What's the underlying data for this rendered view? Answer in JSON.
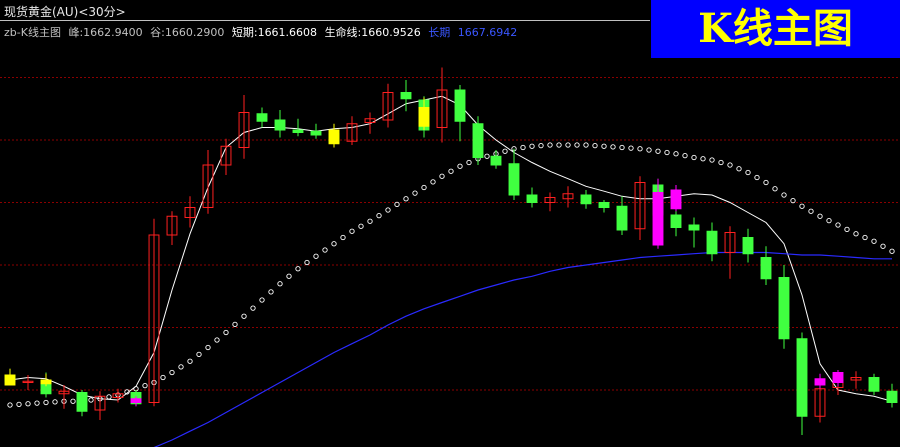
{
  "header": {
    "instrument_title": "现货黄金(AU)<30分>",
    "indicator_name": "zb-K线主图",
    "peak_label": "峰:1662.9400",
    "trough_label": "谷:1660.2900",
    "short_term_label": "短期:1661.6608",
    "lifeline_label": "生命线:1660.9526",
    "long_term_label": "长期",
    "long_term_value": "1667.6942"
  },
  "badge": {
    "text": "K线主图"
  },
  "colors": {
    "background": "#000000",
    "up_candle": "#ff2020",
    "down_candle": "#40ff40",
    "highlight_candle_yellow": "#ffff00",
    "highlight_candle_magenta": "#ff00ff",
    "short_term_line": "#ffffff",
    "long_term_line": "#2a2aff",
    "lifeline_dots": "#ffffff",
    "grid": "#8b0000",
    "badge_bg": "#0000ff",
    "badge_text": "#ffff00"
  },
  "chart_data": {
    "type": "candlestick",
    "title": "现货黄金(AU)<30分>",
    "ylim": [
      1636,
      1668
    ],
    "grid": true,
    "series": [
      {
        "name": "短期",
        "color": "#ffffff",
        "values": [
          1640.8,
          1641.0,
          1640.9,
          1640.3,
          1639.6,
          1639.3,
          1639.2,
          1640.3,
          1643.0,
          1648.0,
          1652.5,
          1656.2,
          1659.4,
          1660.6,
          1661.0,
          1661.0,
          1660.9,
          1660.7,
          1660.9,
          1661.0,
          1661.3,
          1662.1,
          1662.9,
          1663.2,
          1663.5,
          1662.8,
          1661.2,
          1660.0,
          1659.0,
          1658.2,
          1657.5,
          1656.9,
          1656.3,
          1655.9,
          1655.5,
          1655.3,
          1655.3,
          1655.5,
          1655.7,
          1655.6,
          1655.0,
          1654.2,
          1653.4,
          1651.7,
          1647.6,
          1642.1,
          1640.0,
          1639.7,
          1639.5,
          1639.1
        ]
      },
      {
        "name": "生命线",
        "color": "#ffffff",
        "values": [
          1638.8,
          1638.9,
          1639.0,
          1639.1,
          1639.1,
          1639.3,
          1639.6,
          1640.1,
          1640.6,
          1641.4,
          1642.3,
          1643.4,
          1644.6,
          1645.9,
          1647.2,
          1648.5,
          1649.7,
          1650.7,
          1651.7,
          1652.7,
          1653.5,
          1654.4,
          1655.3,
          1656.2,
          1657.1,
          1657.9,
          1658.5,
          1658.9,
          1659.3,
          1659.5,
          1659.6,
          1659.6,
          1659.6,
          1659.5,
          1659.4,
          1659.3,
          1659.1,
          1658.9,
          1658.6,
          1658.4,
          1658.0,
          1657.4,
          1656.6,
          1655.6,
          1654.7,
          1653.9,
          1653.2,
          1652.5,
          1651.9,
          1651.1
        ]
      },
      {
        "name": "长期",
        "color": "#2a2aff",
        "values": [
          1633.8,
          1633.9,
          1634.0,
          1634.1,
          1634.2,
          1634.3,
          1634.5,
          1634.8,
          1635.4,
          1636.0,
          1636.7,
          1637.4,
          1638.2,
          1639.0,
          1639.8,
          1640.6,
          1641.4,
          1642.2,
          1643.0,
          1643.7,
          1644.4,
          1645.2,
          1645.9,
          1646.5,
          1647.0,
          1647.5,
          1648.0,
          1648.4,
          1648.8,
          1649.1,
          1649.5,
          1649.8,
          1650.0,
          1650.2,
          1650.4,
          1650.6,
          1650.7,
          1650.8,
          1650.9,
          1651.0,
          1651.0,
          1651.0,
          1651.0,
          1650.9,
          1650.8,
          1650.8,
          1650.7,
          1650.6,
          1650.5,
          1650.5
        ]
      }
    ],
    "candles": [
      {
        "o": 1641.2,
        "h": 1641.7,
        "l": 1640.6,
        "c": 1640.7
      },
      {
        "o": 1640.6,
        "h": 1641.2,
        "l": 1640.0,
        "c": 1640.7
      },
      {
        "o": 1640.8,
        "h": 1641.4,
        "l": 1639.4,
        "c": 1639.7
      },
      {
        "o": 1639.7,
        "h": 1640.4,
        "l": 1638.5,
        "c": 1639.9
      },
      {
        "o": 1639.8,
        "h": 1640.0,
        "l": 1637.9,
        "c": 1638.3
      },
      {
        "o": 1638.4,
        "h": 1639.9,
        "l": 1637.6,
        "c": 1639.5
      },
      {
        "o": 1639.4,
        "h": 1640.1,
        "l": 1639.0,
        "c": 1639.7
      },
      {
        "o": 1639.8,
        "h": 1640.0,
        "l": 1638.7,
        "c": 1638.9
      },
      {
        "o": 1639.0,
        "h": 1653.7,
        "l": 1638.7,
        "c": 1652.4
      },
      {
        "o": 1652.4,
        "h": 1654.3,
        "l": 1651.6,
        "c": 1653.9
      },
      {
        "o": 1653.8,
        "h": 1655.5,
        "l": 1653.0,
        "c": 1654.6
      },
      {
        "o": 1654.6,
        "h": 1659.2,
        "l": 1654.1,
        "c": 1658.0
      },
      {
        "o": 1658.0,
        "h": 1660.1,
        "l": 1657.2,
        "c": 1659.5
      },
      {
        "o": 1659.4,
        "h": 1663.6,
        "l": 1658.5,
        "c": 1662.2
      },
      {
        "o": 1662.1,
        "h": 1662.6,
        "l": 1661.0,
        "c": 1661.5
      },
      {
        "o": 1661.6,
        "h": 1662.4,
        "l": 1660.2,
        "c": 1660.8
      },
      {
        "o": 1660.8,
        "h": 1661.7,
        "l": 1660.3,
        "c": 1660.6
      },
      {
        "o": 1660.7,
        "h": 1661.3,
        "l": 1660.1,
        "c": 1660.4
      },
      {
        "o": 1660.5,
        "h": 1660.6,
        "l": 1659.4,
        "c": 1659.8
      },
      {
        "o": 1659.9,
        "h": 1661.9,
        "l": 1659.6,
        "c": 1661.3
      },
      {
        "o": 1661.4,
        "h": 1662.2,
        "l": 1660.5,
        "c": 1661.7
      },
      {
        "o": 1661.6,
        "h": 1664.5,
        "l": 1661.0,
        "c": 1663.8
      },
      {
        "o": 1663.8,
        "h": 1664.8,
        "l": 1662.3,
        "c": 1663.3
      },
      {
        "o": 1663.2,
        "h": 1663.5,
        "l": 1660.2,
        "c": 1660.8
      },
      {
        "o": 1661.0,
        "h": 1665.8,
        "l": 1659.8,
        "c": 1664.0
      },
      {
        "o": 1664.0,
        "h": 1664.4,
        "l": 1659.9,
        "c": 1661.5
      },
      {
        "o": 1661.3,
        "h": 1661.9,
        "l": 1658.0,
        "c": 1658.6
      },
      {
        "o": 1658.7,
        "h": 1659.2,
        "l": 1657.7,
        "c": 1658.0
      },
      {
        "o": 1658.1,
        "h": 1659.3,
        "l": 1655.2,
        "c": 1655.6
      },
      {
        "o": 1655.6,
        "h": 1656.2,
        "l": 1654.6,
        "c": 1655.0
      },
      {
        "o": 1655.0,
        "h": 1655.8,
        "l": 1654.3,
        "c": 1655.4
      },
      {
        "o": 1655.3,
        "h": 1656.3,
        "l": 1654.6,
        "c": 1655.7
      },
      {
        "o": 1655.6,
        "h": 1656.0,
        "l": 1654.5,
        "c": 1654.9
      },
      {
        "o": 1655.0,
        "h": 1655.2,
        "l": 1654.2,
        "c": 1654.6
      },
      {
        "o": 1654.7,
        "h": 1655.5,
        "l": 1652.4,
        "c": 1652.8
      },
      {
        "o": 1652.9,
        "h": 1657.1,
        "l": 1652.0,
        "c": 1656.6
      },
      {
        "o": 1656.4,
        "h": 1656.9,
        "l": 1653.5,
        "c": 1654.0
      },
      {
        "o": 1654.0,
        "h": 1654.4,
        "l": 1652.3,
        "c": 1653.0
      },
      {
        "o": 1653.2,
        "h": 1653.8,
        "l": 1651.4,
        "c": 1652.8
      },
      {
        "o": 1652.7,
        "h": 1653.4,
        "l": 1650.3,
        "c": 1650.9
      },
      {
        "o": 1651.0,
        "h": 1653.1,
        "l": 1648.9,
        "c": 1652.6
      },
      {
        "o": 1652.2,
        "h": 1652.9,
        "l": 1650.2,
        "c": 1650.9
      },
      {
        "o": 1650.6,
        "h": 1651.5,
        "l": 1648.4,
        "c": 1648.9
      },
      {
        "o": 1649.0,
        "h": 1650.0,
        "l": 1643.3,
        "c": 1644.1
      },
      {
        "o": 1644.1,
        "h": 1644.6,
        "l": 1636.4,
        "c": 1637.9
      },
      {
        "o": 1637.9,
        "h": 1640.8,
        "l": 1637.4,
        "c": 1640.1
      },
      {
        "o": 1640.2,
        "h": 1641.4,
        "l": 1639.6,
        "c": 1640.8
      },
      {
        "o": 1640.8,
        "h": 1641.5,
        "l": 1640.1,
        "c": 1641.0
      },
      {
        "o": 1641.0,
        "h": 1641.3,
        "l": 1639.6,
        "c": 1639.9
      },
      {
        "o": 1639.9,
        "h": 1640.5,
        "l": 1638.6,
        "c": 1639.0
      }
    ],
    "highlight_candles": [
      {
        "o": 1641.2,
        "h": 1641.7,
        "l": 1640.8,
        "c": 1640.4,
        "color": "#ffff00",
        "index": 0
      },
      {
        "o": 1640.8,
        "h": 1641.3,
        "l": 1640.3,
        "c": 1640.5,
        "color": "#ffff00",
        "index": 2
      },
      {
        "o": 1639.3,
        "h": 1639.5,
        "l": 1638.7,
        "c": 1639.0,
        "color": "#ff00ff",
        "index": 7
      },
      {
        "o": 1660.8,
        "h": 1661.3,
        "l": 1659.4,
        "c": 1659.7,
        "color": "#ffff00",
        "index": 18
      },
      {
        "o": 1662.6,
        "h": 1663.4,
        "l": 1660.8,
        "c": 1661.1,
        "color": "#ffff00",
        "index": 23
      },
      {
        "o": 1655.8,
        "h": 1656.9,
        "l": 1651.3,
        "c": 1651.6,
        "color": "#ff00ff",
        "index": 36
      },
      {
        "o": 1656.0,
        "h": 1656.4,
        "l": 1654.3,
        "c": 1654.5,
        "color": "#ff00ff",
        "index": 37
      },
      {
        "o": 1640.9,
        "h": 1641.3,
        "l": 1640.1,
        "c": 1640.4,
        "color": "#ff00ff",
        "index": 45
      },
      {
        "o": 1641.4,
        "h": 1641.6,
        "l": 1640.3,
        "c": 1640.6,
        "color": "#ff00ff",
        "index": 46
      }
    ],
    "grid_levels": [
      1665,
      1660,
      1655,
      1650,
      1645,
      1640,
      1635
    ]
  }
}
